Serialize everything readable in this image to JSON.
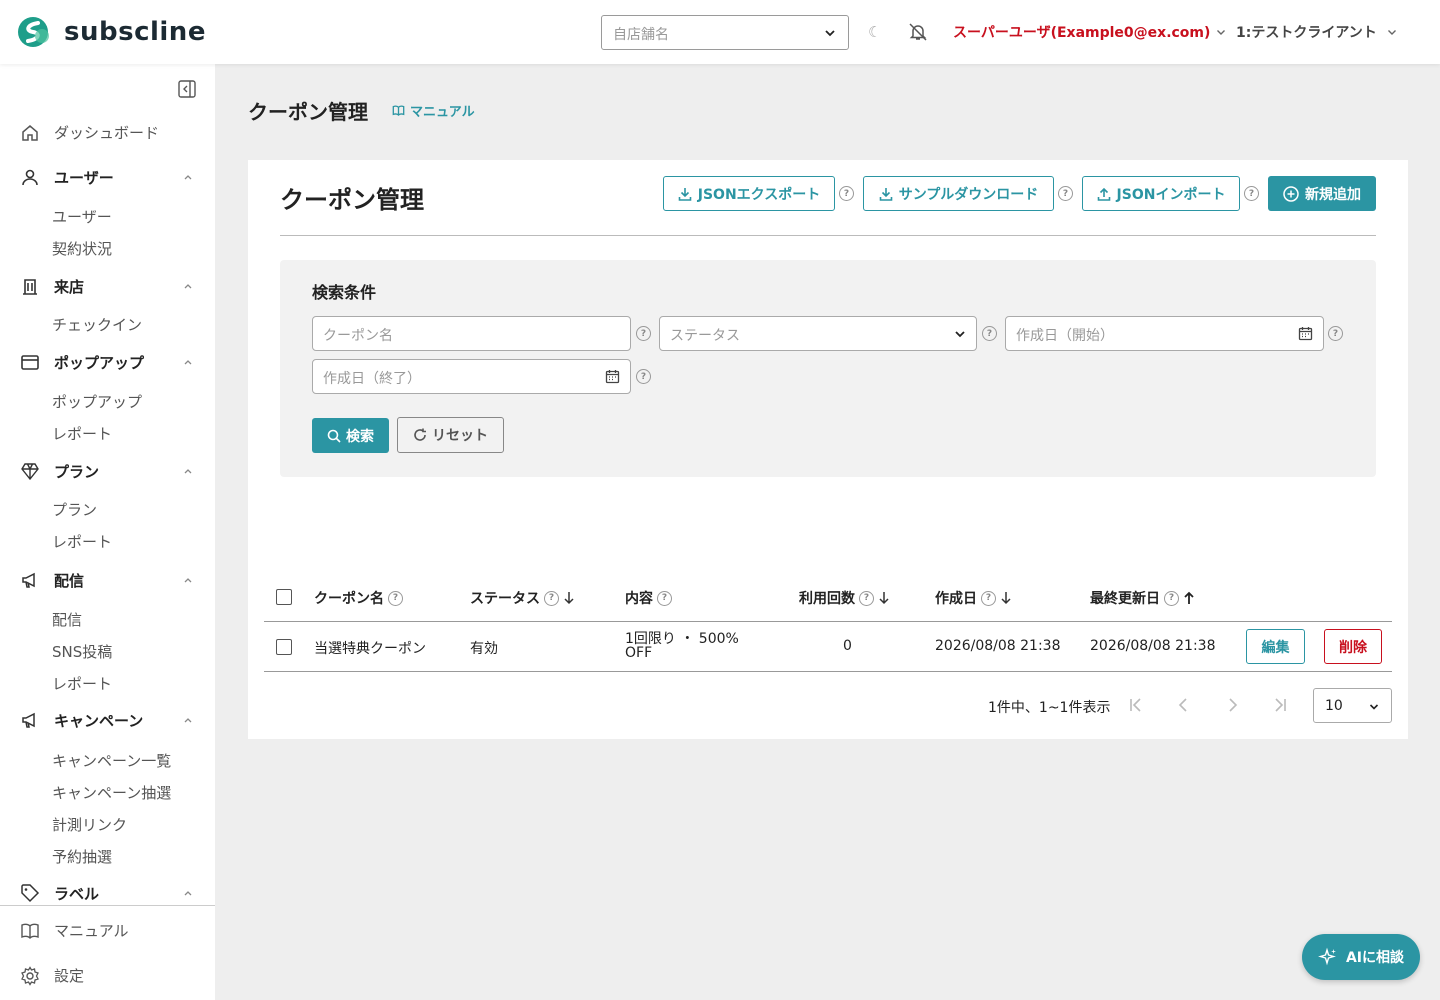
{
  "app": {
    "name": "subscline",
    "accent": "#2b95a3",
    "danger": "#c8101e"
  },
  "header": {
    "store_placeholder": "自店舗名",
    "user_label": "スーパーユーザ(Example0@ex.com)",
    "client_label": "1:テストクライアント"
  },
  "sidebar": {
    "dashboard": "ダッシュボード",
    "sections": [
      {
        "label": "ユーザー",
        "icon": "user-icon",
        "items": [
          "ユーザー",
          "契約状況"
        ]
      },
      {
        "label": "来店",
        "icon": "building-icon",
        "items": [
          "チェックイン"
        ]
      },
      {
        "label": "ポップアップ",
        "icon": "window-icon",
        "items": [
          "ポップアップ",
          "レポート"
        ]
      },
      {
        "label": "プラン",
        "icon": "diamond-icon",
        "items": [
          "プラン",
          "レポート"
        ]
      },
      {
        "label": "配信",
        "icon": "megaphone-icon",
        "items": [
          "配信",
          "SNS投稿",
          "レポート"
        ]
      },
      {
        "label": "キャンペーン",
        "icon": "megaphone-icon",
        "items": [
          "キャンペーン一覧",
          "キャンペーン抽選",
          "計測リンク",
          "予約抽選"
        ]
      },
      {
        "label": "ラベル",
        "icon": "tag-icon",
        "items": []
      }
    ],
    "bottom": {
      "manual": "マニュアル",
      "settings": "設定"
    }
  },
  "page": {
    "title": "クーポン管理",
    "manual_link": "マニュアル"
  },
  "card": {
    "title": "クーポン管理",
    "buttons": {
      "json_export": "JSONエクスポート",
      "sample_download": "サンプルダウンロード",
      "json_import": "JSONインポート",
      "add_new": "新規追加"
    }
  },
  "search": {
    "title": "検索条件",
    "coupon_name_placeholder": "クーポン名",
    "status_placeholder": "ステータス",
    "created_start_placeholder": "作成日（開始）",
    "created_end_placeholder": "作成日（終了）",
    "search_button": "検索",
    "reset_button": "リセット"
  },
  "table": {
    "help_glyph": "?",
    "columns": {
      "name": "クーポン名",
      "status": "ステータス",
      "content": "内容",
      "usage": "利用回数",
      "created": "作成日",
      "updated": "最終更新日"
    },
    "rows": [
      {
        "name": "当選特典クーポン",
        "status": "有効",
        "content_line1": "1回限り ・ 500%",
        "content_line2": "OFF",
        "usage": "0",
        "created": "2026/08/08 21:38",
        "updated": "2026/08/08 21:38",
        "edit": "編集",
        "delete": "削除"
      }
    ]
  },
  "pagination": {
    "info": "1件中、1~1件表示",
    "page_size": "10"
  },
  "ai_button": "AIに相談"
}
